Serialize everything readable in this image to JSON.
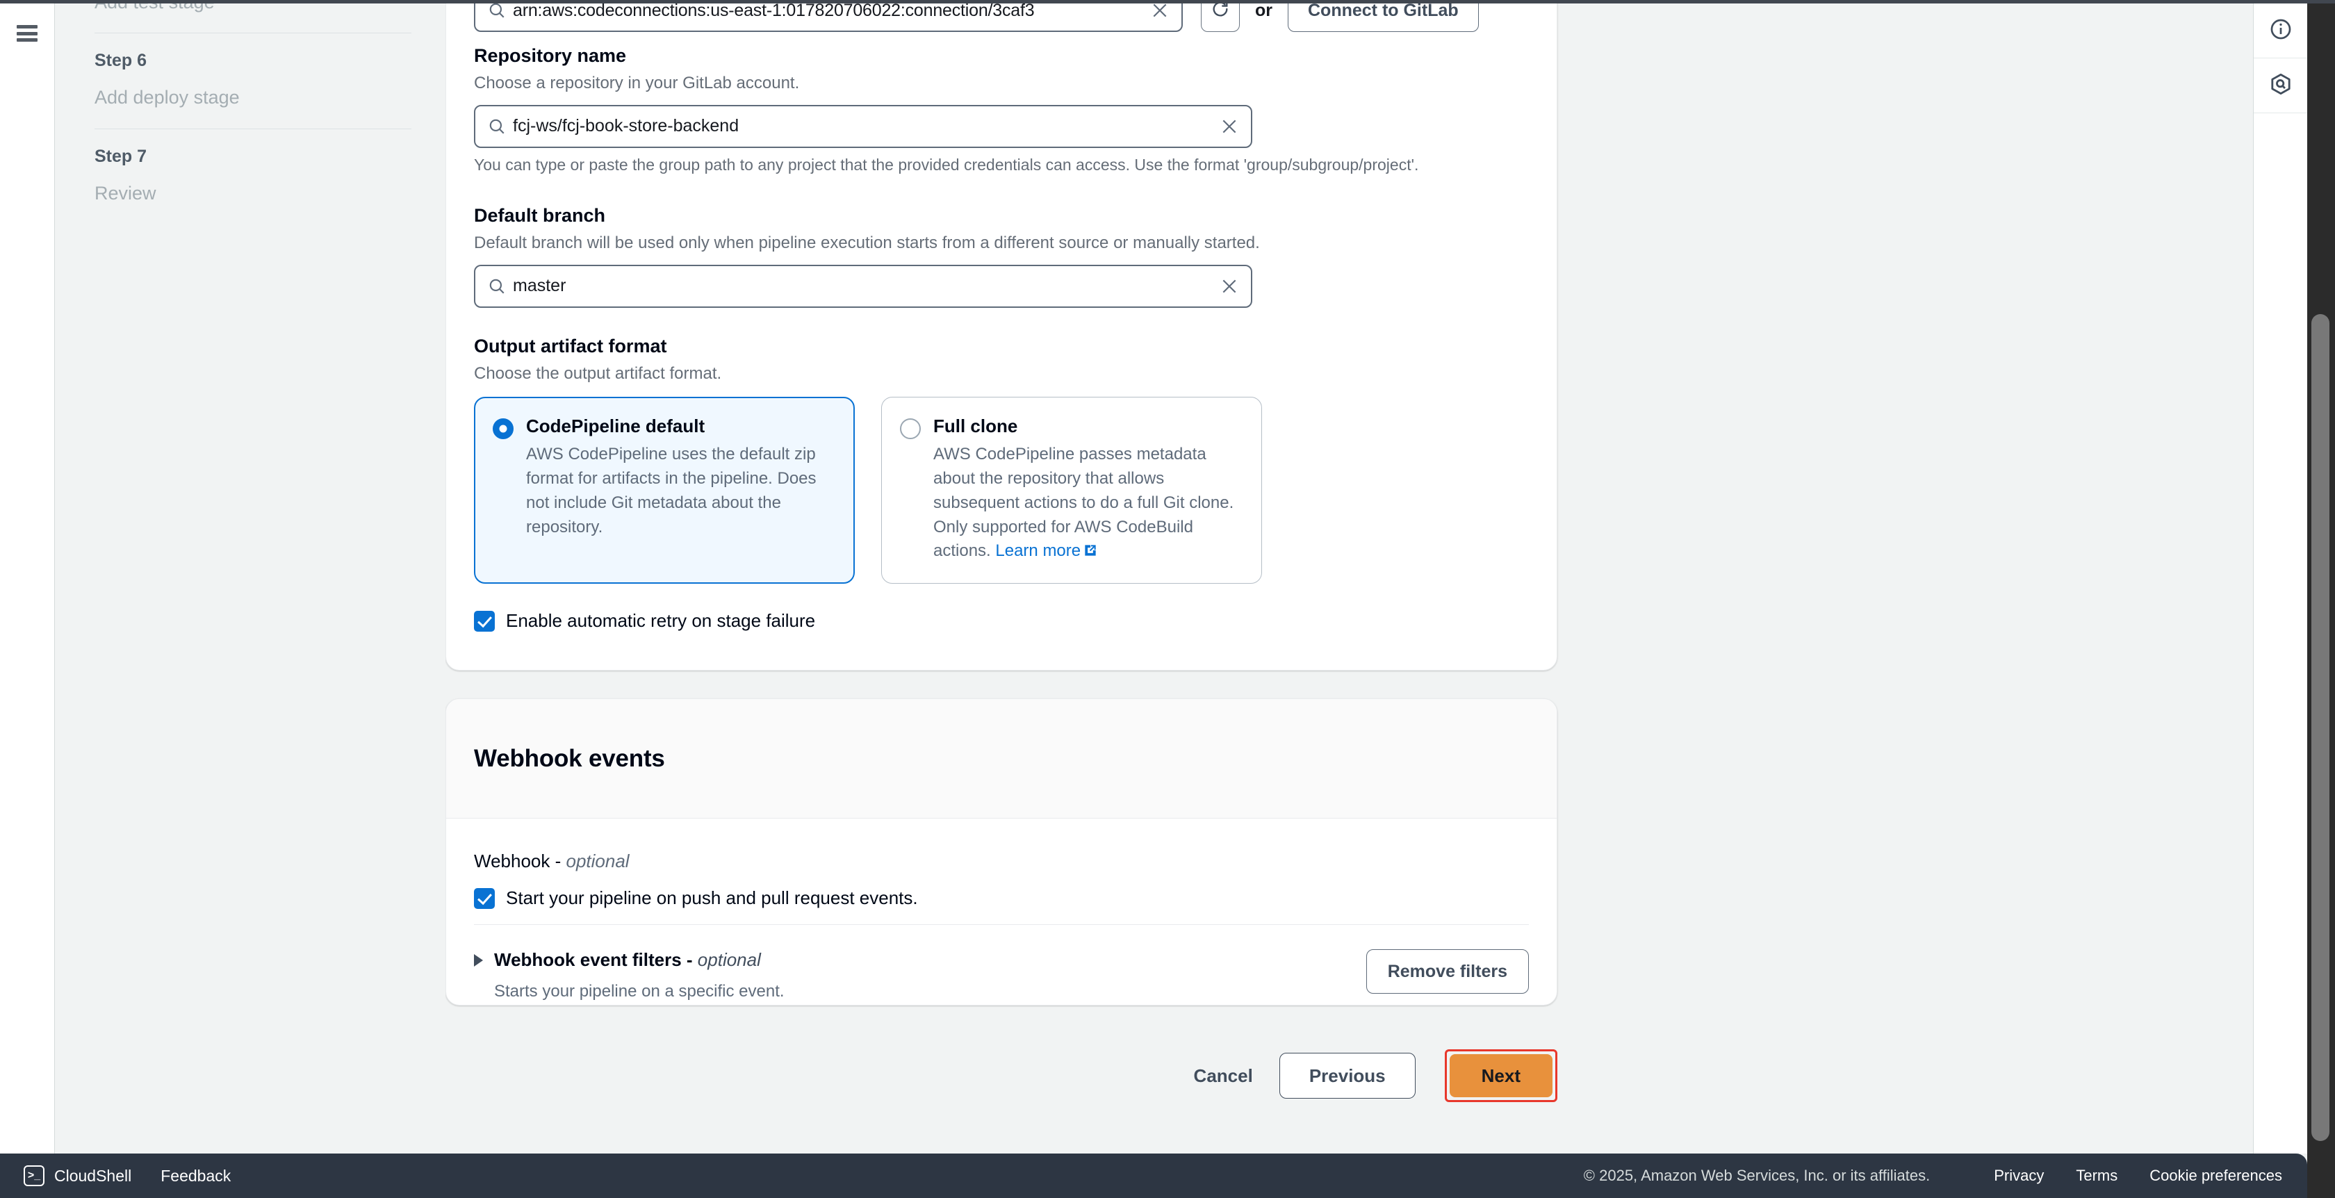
{
  "sidebar": {
    "steps": [
      {
        "label_clipped": "Add test stage"
      },
      {
        "kicker": "Step 6",
        "label": "Add deploy stage"
      },
      {
        "kicker": "Step 7",
        "label": "Review"
      }
    ]
  },
  "source_card": {
    "connection": {
      "value": "arn:aws:codeconnections:us-east-1:017820706022:connection/3caf3",
      "refresh_tooltip": "Refresh",
      "or_text": "or",
      "connect_button": "Connect to GitLab"
    },
    "repository_name": {
      "label": "Repository name",
      "description": "Choose a repository in your GitLab account.",
      "value": "fcj-ws/fcj-book-store-backend",
      "hint": "You can type or paste the group path to any project that the provided credentials can access. Use the format 'group/subgroup/project'."
    },
    "default_branch": {
      "label": "Default branch",
      "description": "Default branch will be used only when pipeline execution starts from a different source or manually started.",
      "value": "master"
    },
    "output_artifact_format": {
      "label": "Output artifact format",
      "description": "Choose the output artifact format.",
      "options": [
        {
          "title": "CodePipeline default",
          "description": "AWS CodePipeline uses the default zip format for artifacts in the pipeline. Does not include Git metadata about the repository.",
          "selected": true
        },
        {
          "title": "Full clone",
          "description": "AWS CodePipeline passes metadata about the repository that allows subsequent actions to do a full Git clone. Only supported for AWS CodeBuild actions.",
          "link_text": "Learn more",
          "selected": false
        }
      ]
    },
    "auto_retry": {
      "label": "Enable automatic retry on stage failure",
      "checked": true
    }
  },
  "webhook_card": {
    "title": "Webhook events",
    "webhook_label_text": "Webhook - ",
    "webhook_label_optional": "optional",
    "start_pipeline": {
      "label": "Start your pipeline on push and pull request events.",
      "checked": true
    },
    "filters": {
      "title_text": "Webhook event filters - ",
      "title_optional": "optional",
      "description": "Starts your pipeline on a specific event.",
      "remove_button": "Remove filters"
    }
  },
  "actions": {
    "cancel": "Cancel",
    "previous": "Previous",
    "next": "Next"
  },
  "right_rail": {
    "info_icon": "info-icon",
    "amazon_q_icon": "amazon-q-icon"
  },
  "console_footer": {
    "cloudshell": "CloudShell",
    "feedback": "Feedback",
    "copyright": "© 2025, Amazon Web Services, Inc. or its affiliates.",
    "privacy": "Privacy",
    "terms": "Terms",
    "cookie_preferences": "Cookie preferences"
  },
  "colors": {
    "accent_blue": "#0972d3",
    "next_orange": "#e8913c",
    "highlight_red": "#e8372b",
    "console_dark": "#2d3643"
  }
}
